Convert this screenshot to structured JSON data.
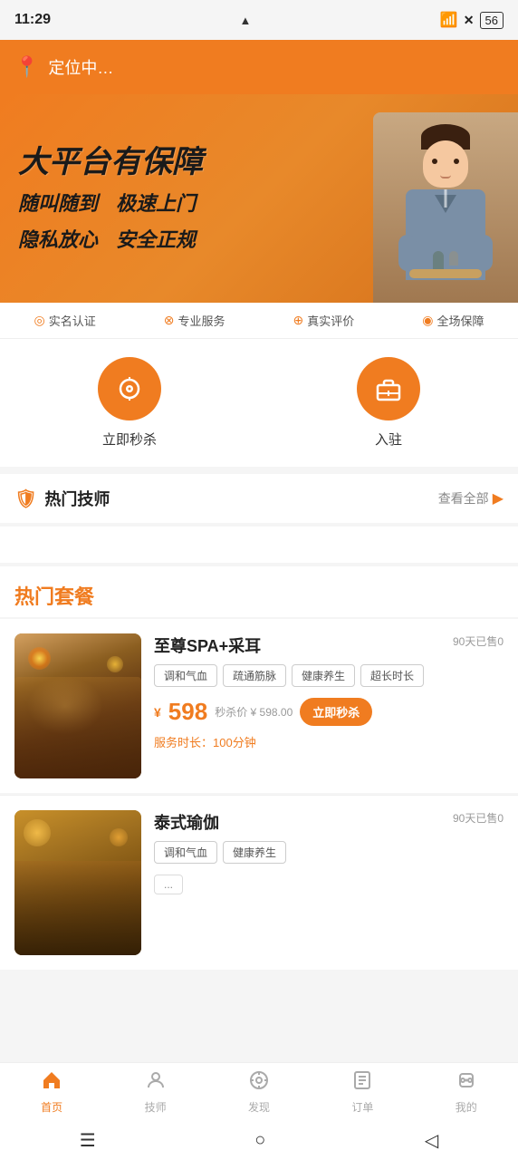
{
  "statusBar": {
    "time": "11:29",
    "alert": "▲",
    "wifi": "WiFi",
    "battery": "56"
  },
  "header": {
    "locationIcon": "📍",
    "locationText": "定位中…"
  },
  "banner": {
    "titleBig": "大平台有保障",
    "row1Left": "随叫随到",
    "row1Right": "极速上门",
    "row2Left": "隐私放心",
    "row2Right": "安全正规"
  },
  "trustBar": {
    "items": [
      {
        "icon": "◎",
        "label": "实名认证"
      },
      {
        "icon": "⊗",
        "label": "专业服务"
      },
      {
        "icon": "⊕",
        "label": "真实评价"
      },
      {
        "icon": "◉",
        "label": "全场保障"
      }
    ]
  },
  "quickActions": [
    {
      "icon": "👁",
      "label": "立即秒杀"
    },
    {
      "icon": "💼",
      "label": "入驻"
    }
  ],
  "hotTechnician": {
    "sectionIcon": "🛡",
    "sectionTitle": "热门技师",
    "moreLabel": "查看全部",
    "moreArrow": "▶"
  },
  "hotPackages": {
    "sectionTitle": "热门套餐",
    "packages": [
      {
        "name": "至尊SPA+采耳",
        "sold": "90天已售0",
        "tags": [
          "调和气血",
          "疏通筋脉",
          "健康养生",
          "超长时长"
        ],
        "price": "598",
        "pricePrefix": "¥",
        "seckillPrice": "¥ 598.00",
        "seckillLabel": "立即秒杀",
        "duration": "服务时长：100分钟",
        "seckillText": "秒杀价"
      },
      {
        "name": "泰式瑜伽",
        "sold": "90天已售0",
        "tags": [
          "调和气血",
          "健康养生"
        ],
        "price": "",
        "pricePrefix": "",
        "seckillLabel": "",
        "duration": ""
      }
    ]
  },
  "bottomNav": {
    "items": [
      {
        "icon": "🏠",
        "label": "首页",
        "active": true
      },
      {
        "icon": "👤",
        "label": "技师",
        "active": false
      },
      {
        "icon": "⊛",
        "label": "发现",
        "active": false
      },
      {
        "icon": "📋",
        "label": "订单",
        "active": false
      },
      {
        "icon": "⋯",
        "label": "我的",
        "active": false
      }
    ]
  },
  "systemNav": {
    "menu": "☰",
    "home": "○",
    "back": "◁"
  }
}
